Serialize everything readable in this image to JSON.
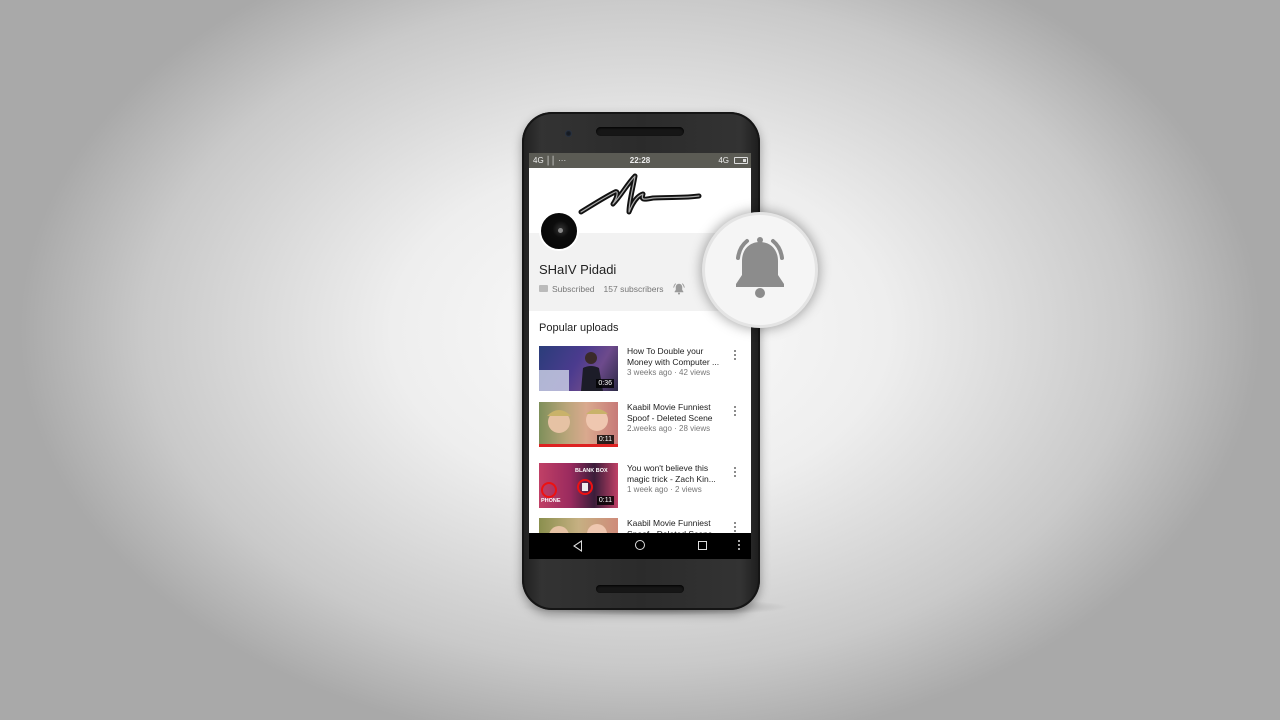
{
  "status_bar": {
    "left": "4G ││ ···",
    "time": "22:28",
    "right": "4G"
  },
  "channel": {
    "name": "SHaIV Pidadi",
    "subscribe_status": "Subscribed",
    "subscriber_count": "157 subscribers"
  },
  "section": {
    "title": "Popular uploads"
  },
  "videos": [
    {
      "title": "How To Double your Money with Computer ...",
      "meta": "3 weeks ago · 42 views",
      "duration": "0:36"
    },
    {
      "title": "Kaabil Movie Funniest Spoof - Deleted Scene ...",
      "meta": "2 weeks ago · 28 views",
      "duration": "0:11"
    },
    {
      "title": "You won't believe this magic trick - Zach Kin...",
      "meta": "1 week ago · 2 views",
      "duration": "0:11"
    },
    {
      "title": "Kaabil Movie Funniest Spoof - Deleted Scene ...",
      "meta": "",
      "duration": ""
    }
  ],
  "thumb_labels": {
    "blank_box": "BLANK BOX",
    "phone": "PHONE"
  },
  "icons": {
    "notification": "bell-icon",
    "overflow": "more-vert-icon",
    "back": "back-icon",
    "home": "home-icon",
    "recents": "recents-icon"
  }
}
